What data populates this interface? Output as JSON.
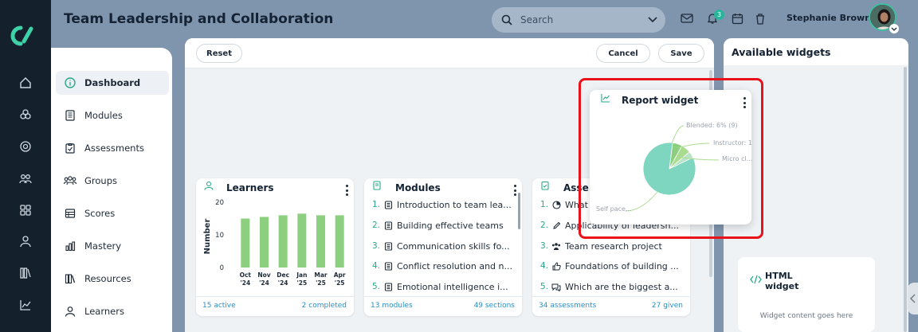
{
  "header": {
    "title": "Team Leadership and Collaboration",
    "search_placeholder": "Search",
    "notification_count": "3",
    "user_name": "Stephanie Brown"
  },
  "sidebar": {
    "items": [
      {
        "label": "Dashboard",
        "icon": "info-circle-icon",
        "active": true
      },
      {
        "label": "Modules",
        "icon": "book-icon"
      },
      {
        "label": "Assessments",
        "icon": "clipboard-icon"
      },
      {
        "label": "Groups",
        "icon": "users-icon"
      },
      {
        "label": "Scores",
        "icon": "table-icon"
      },
      {
        "label": "Mastery",
        "icon": "bar-chart-icon"
      },
      {
        "label": "Resources",
        "icon": "books-icon"
      },
      {
        "label": "Learners",
        "icon": "user-icon"
      }
    ]
  },
  "toolbar": {
    "reset": "Reset",
    "cancel": "Cancel",
    "save": "Save"
  },
  "learners_card": {
    "title": "Learners",
    "ylabel": "Number",
    "footer_left": "15 active",
    "footer_right": "2 completed",
    "chart_data": {
      "type": "bar",
      "categories": [
        "Oct\n'24",
        "Nov\n'24",
        "Dec\n'24",
        "Jan\n'25",
        "Mar\n'25",
        "Apr\n'25"
      ],
      "tick_labels": [
        [
          "Oct",
          "'24"
        ],
        [
          "Nov",
          "'24"
        ],
        [
          "Dec",
          "'24"
        ],
        [
          "Jan",
          "'25"
        ],
        [
          "Mar",
          "'25"
        ],
        [
          "Apr",
          "'25"
        ]
      ],
      "values": [
        15,
        15.5,
        16,
        16.5,
        16,
        16
      ],
      "ylabel": "Number",
      "ylim": [
        0,
        20
      ],
      "yticks": [
        "20",
        "10",
        "0"
      ],
      "color": "#8ccf7e"
    }
  },
  "modules_card": {
    "title": "Modules",
    "items": [
      {
        "n": "1.",
        "text": "Introduction to team lea..."
      },
      {
        "n": "2.",
        "text": "Building effective teams"
      },
      {
        "n": "3.",
        "text": "Communication skills fo..."
      },
      {
        "n": "4.",
        "text": "Conflict resolution and n..."
      },
      {
        "n": "5.",
        "text": "Emotional intelligence i..."
      }
    ],
    "footer_left": "13 modules",
    "footer_right": "49 sections"
  },
  "assessments_card": {
    "title": "Asse",
    "items": [
      {
        "n": "1.",
        "text": "What",
        "icon": "pie-icon"
      },
      {
        "n": "2.",
        "text": "Applicability of leadersh...",
        "icon": "pencil-icon"
      },
      {
        "n": "3.",
        "text": "Team research project",
        "icon": "users-icon"
      },
      {
        "n": "4.",
        "text": "Foundations of building ...",
        "icon": "thumbs-up-icon"
      },
      {
        "n": "5.",
        "text": "Which are the biggest a...",
        "icon": "chat-icon"
      }
    ],
    "footer_left": "34 assessments",
    "footer_right": "27 given"
  },
  "report_widget": {
    "title": "Report widget",
    "chart_data": {
      "type": "pie",
      "labels": [
        "Self pace...",
        "Blended: 6% (9)",
        "Instructor: 1",
        "Micro cl..."
      ],
      "values": [
        84,
        6,
        6,
        4
      ],
      "colors": [
        "#7fd6c0",
        "#8ccf7e",
        "#a9dc8f",
        "#b9e2c6"
      ]
    }
  },
  "right_panel": {
    "title": "Available widgets",
    "html_widget_title": "HTML widget",
    "html_widget_body": "Widget content goes here"
  },
  "colors": {
    "accent": "#2aa889",
    "link": "#2a90c8",
    "highlight": "#e8121a"
  }
}
